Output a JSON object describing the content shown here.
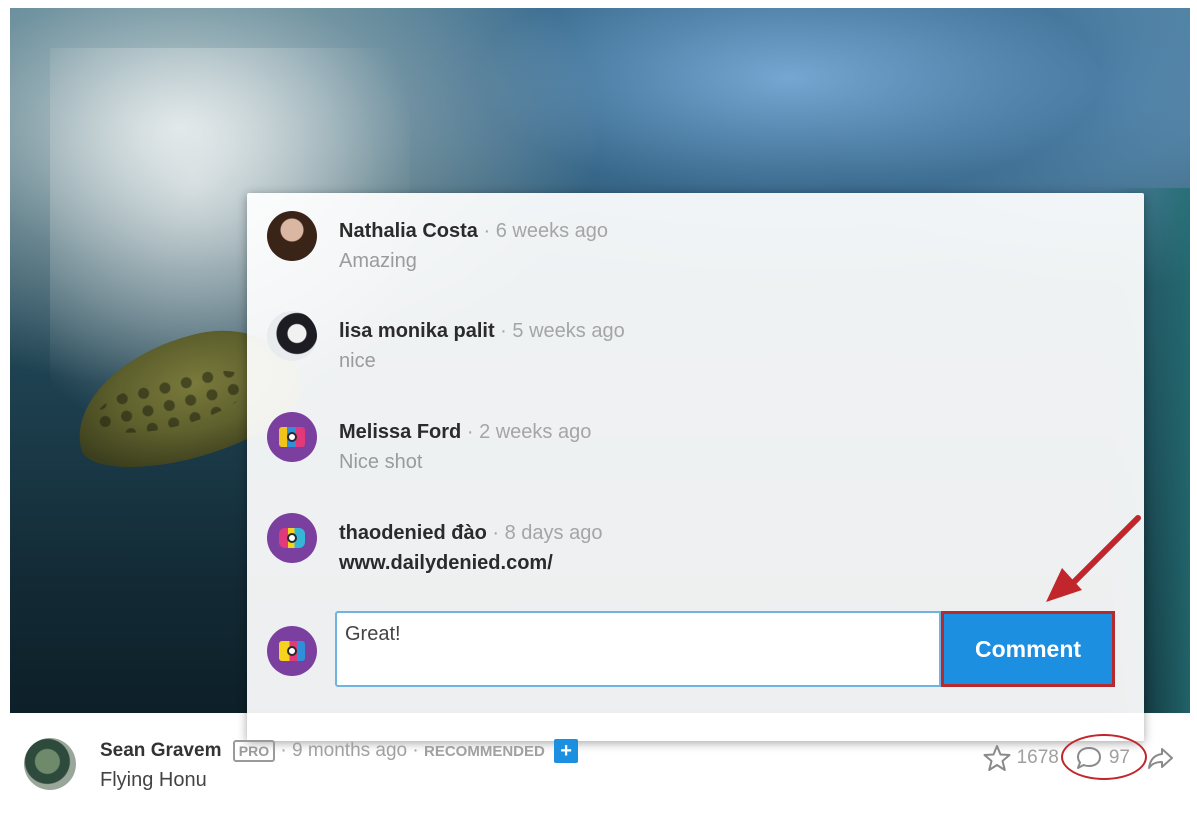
{
  "comments": [
    {
      "name": "Nathalia Costa",
      "separator": "·",
      "time": "6 weeks ago",
      "text": "Amazing"
    },
    {
      "name": "lisa monika palit",
      "separator": "·",
      "time": "5 weeks ago",
      "text": "nice"
    },
    {
      "name": "Melissa Ford",
      "separator": "·",
      "time": "2 weeks ago",
      "text": "Nice shot"
    },
    {
      "name": "thaodenied đào",
      "separator": "·",
      "time": "8 days ago",
      "text": "www.dailydenied.com/"
    }
  ],
  "composer": {
    "value": "Great!",
    "button_label": "Comment"
  },
  "photo_info": {
    "author": "Sean Gravem",
    "badge": "PRO",
    "meta": "· 9 months ago ·",
    "recommended": "RECOMMENDED",
    "plus": "+",
    "title": "Flying Honu",
    "likes": "1678",
    "comments_count": "97"
  },
  "colors": {
    "accent_blue": "#1d8fe1",
    "annotation_red": "#c0262b",
    "avatar_purple": "#7b3fa0"
  },
  "icons": {
    "star": "star-icon",
    "comment": "comment-bubble-icon",
    "share": "share-arrow-icon",
    "annotation": "red-arrow-annotation"
  }
}
